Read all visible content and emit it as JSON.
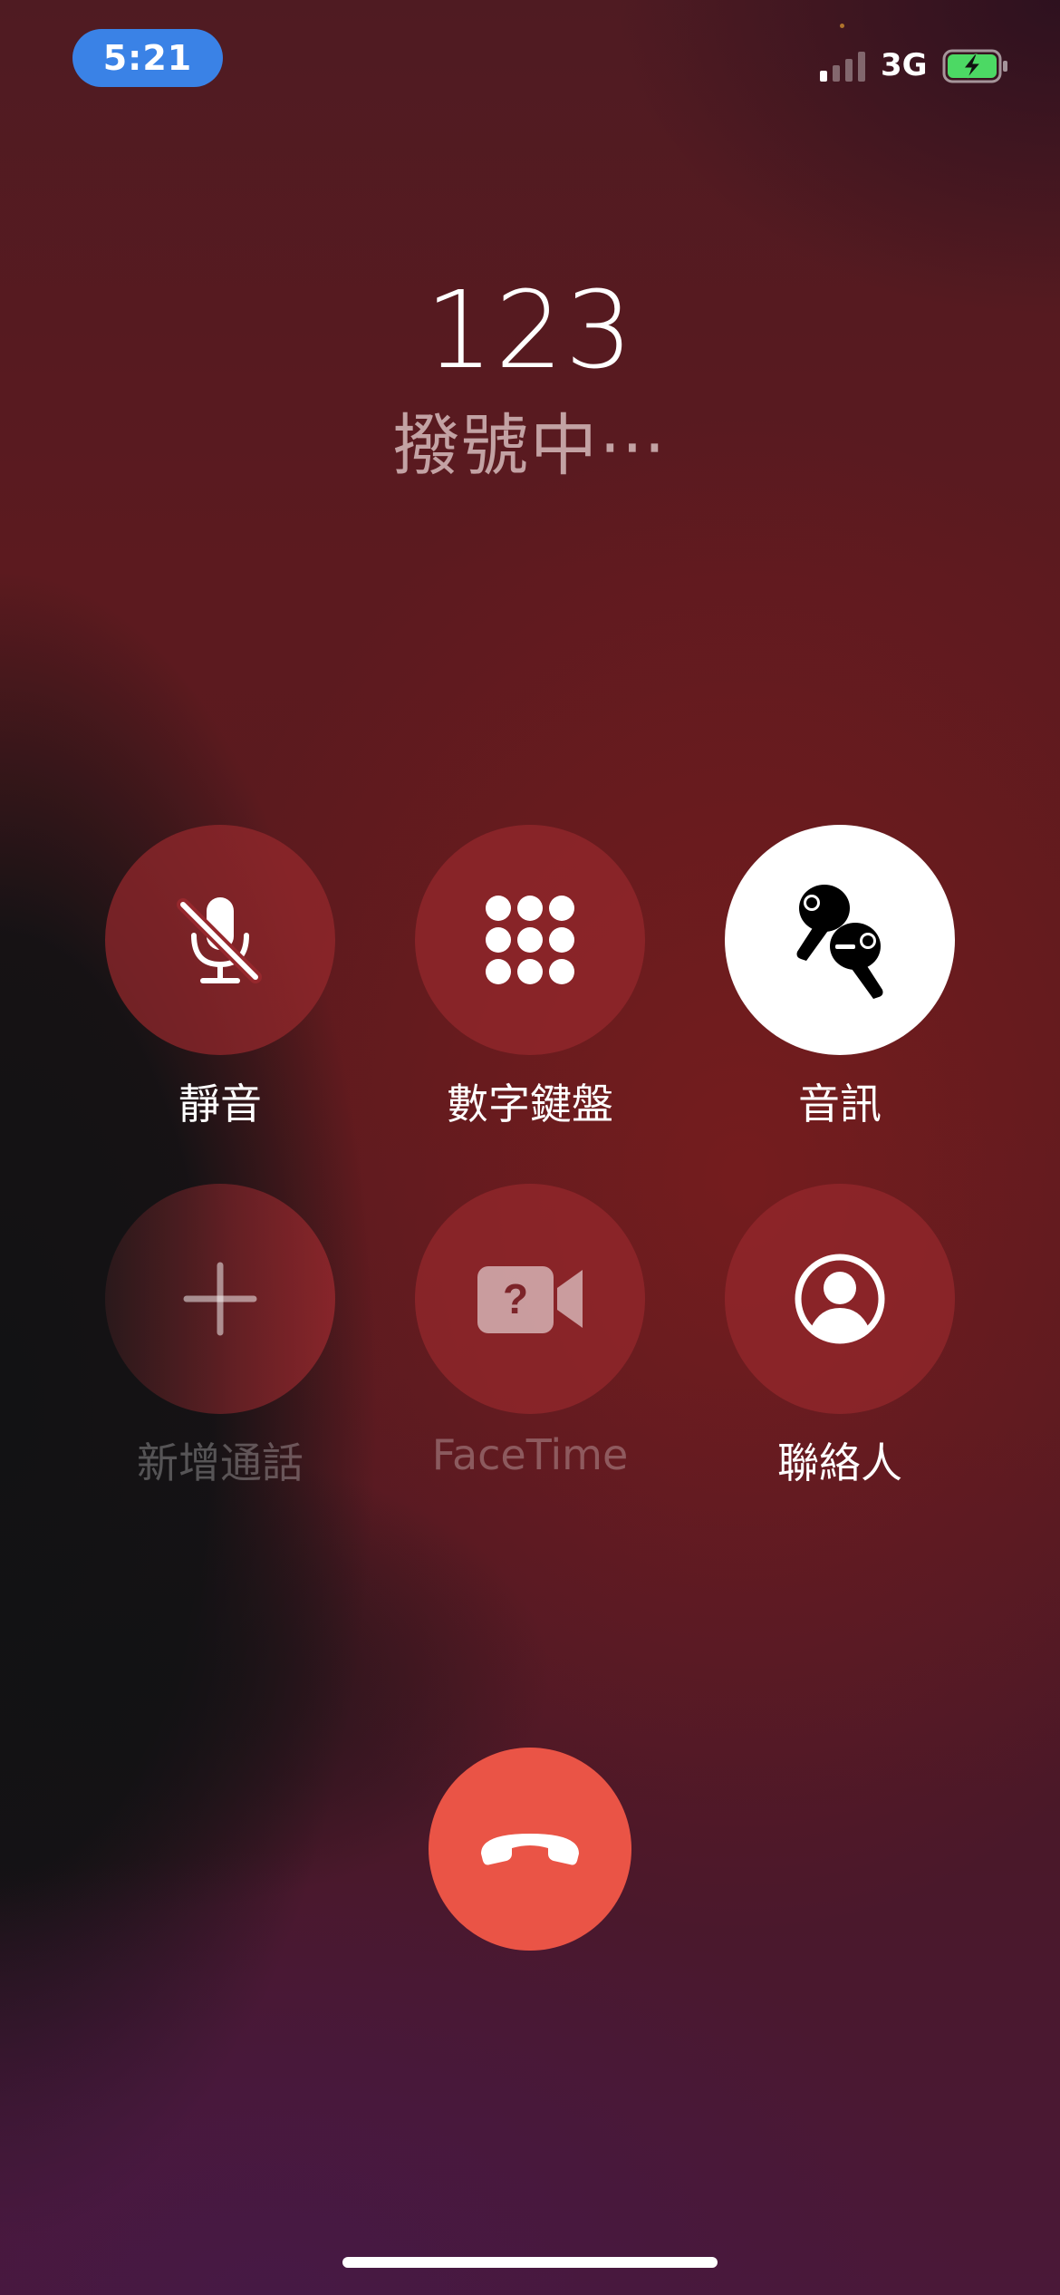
{
  "status_bar": {
    "time": "5:21",
    "network": "3G",
    "signal_bars_active": 1,
    "signal_bars_total": 4,
    "battery_charging": true,
    "battery_color": "#4cd964",
    "time_pill_color": "#3a82e6"
  },
  "call": {
    "number": "123",
    "status": "撥號中⋯"
  },
  "controls": {
    "mute": {
      "label": "靜音",
      "icon": "mic-slash-icon"
    },
    "keypad": {
      "label": "數字鍵盤",
      "icon": "keypad-icon"
    },
    "audio": {
      "label": "音訊",
      "icon": "airpods-icon",
      "active": true
    },
    "add_call": {
      "label": "新增通話",
      "icon": "plus-icon",
      "disabled": true
    },
    "facetime": {
      "label": "FaceTime",
      "icon": "facetime-video-question-icon",
      "disabled": true
    },
    "contacts": {
      "label": "聯絡人",
      "icon": "person-circle-icon"
    }
  },
  "end_call": {
    "icon": "phone-down-icon",
    "color": "#ea5446"
  }
}
